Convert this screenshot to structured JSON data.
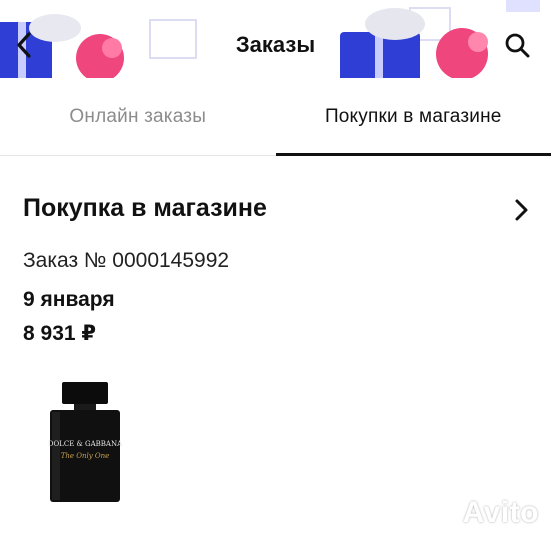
{
  "header": {
    "title": "Заказы",
    "back_icon": "chevron-left-icon",
    "search_icon": "search-icon"
  },
  "tabs": [
    {
      "label": "Онлайн заказы",
      "active": false
    },
    {
      "label": "Покупки в магазине",
      "active": true
    }
  ],
  "order": {
    "title": "Покупка в магазине",
    "number": "Заказ № 0000145992",
    "date": "9 января",
    "sum": "8 931 ₽",
    "product_image": "perfume-bottle",
    "product_brand_text": "DOLCE & GABBANA",
    "product_name_text": "The Only One"
  },
  "watermark": "Avito",
  "colors": {
    "accent_blue": "#2f3fd6",
    "accent_pink": "#f0467e",
    "active_tab": "#111111",
    "inactive_tab": "#8c8c8c"
  }
}
